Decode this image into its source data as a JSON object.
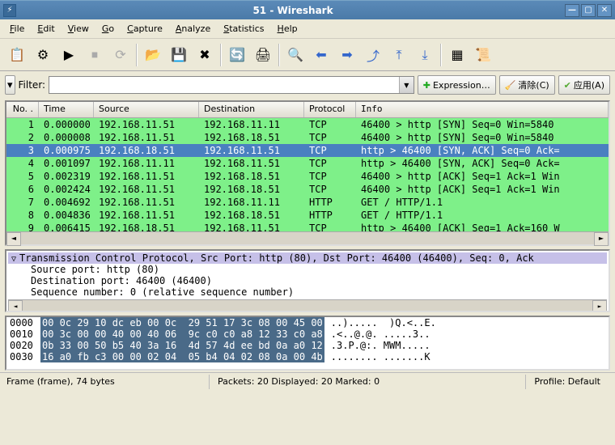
{
  "window": {
    "title": "51 - Wireshark"
  },
  "menubar": [
    "File",
    "Edit",
    "View",
    "Go",
    "Capture",
    "Analyze",
    "Statistics",
    "Help"
  ],
  "filterbar": {
    "filter_label": "Filter:",
    "expression_label": "Expression…",
    "clear_label": "清除(C)",
    "apply_label": "应用(A)",
    "filter_value": ""
  },
  "columns": [
    "No. .",
    "Time",
    "Source",
    "Destination",
    "Protocol",
    "Info"
  ],
  "rows": [
    {
      "no": "1",
      "time": "0.000000",
      "src": "192.168.11.51",
      "dst": "192.168.11.11",
      "proto": "TCP",
      "info": "46400 > http [SYN] Seq=0 Win=5840",
      "sel": false
    },
    {
      "no": "2",
      "time": "0.000008",
      "src": "192.168.11.51",
      "dst": "192.168.18.51",
      "proto": "TCP",
      "info": "46400 > http [SYN] Seq=0 Win=5840",
      "sel": false
    },
    {
      "no": "3",
      "time": "0.000975",
      "src": "192.168.18.51",
      "dst": "192.168.11.51",
      "proto": "TCP",
      "info": "http > 46400 [SYN, ACK] Seq=0 Ack=",
      "sel": true
    },
    {
      "no": "4",
      "time": "0.001097",
      "src": "192.168.11.11",
      "dst": "192.168.11.51",
      "proto": "TCP",
      "info": "http > 46400 [SYN, ACK] Seq=0 Ack=",
      "sel": false
    },
    {
      "no": "5",
      "time": "0.002319",
      "src": "192.168.11.51",
      "dst": "192.168.18.51",
      "proto": "TCP",
      "info": "46400 > http [ACK] Seq=1 Ack=1 Win",
      "sel": false
    },
    {
      "no": "6",
      "time": "0.002424",
      "src": "192.168.11.51",
      "dst": "192.168.18.51",
      "proto": "TCP",
      "info": "46400 > http [ACK] Seq=1 Ack=1 Win",
      "sel": false
    },
    {
      "no": "7",
      "time": "0.004692",
      "src": "192.168.11.51",
      "dst": "192.168.11.11",
      "proto": "HTTP",
      "info": "GET / HTTP/1.1",
      "sel": false
    },
    {
      "no": "8",
      "time": "0.004836",
      "src": "192.168.11.51",
      "dst": "192.168.18.51",
      "proto": "HTTP",
      "info": "GET / HTTP/1.1",
      "sel": false
    },
    {
      "no": "9",
      "time": "0.006415",
      "src": "192.168.18.51",
      "dst": "192.168.11.51",
      "proto": "TCP",
      "info": "http > 46400 [ACK] Seq=1 Ack=160 W",
      "sel": false
    }
  ],
  "detail": {
    "head": "Transmission Control Protocol, Src Port: http (80), Dst Port: 46400 (46400), Seq: 0, Ack",
    "lines": [
      "Source port: http (80)",
      "Destination port: 46400 (46400)",
      "Sequence number: 0    (relative sequence number)"
    ]
  },
  "hex": [
    {
      "off": "0000",
      "b": "00 0c 29 10 dc eb 00 0c  29 51 17 3c 08 00 45 00",
      "a": "..).....  )Q.<..E."
    },
    {
      "off": "0010",
      "b": "00 3c 00 00 40 00 40 06  9c c0 c0 a8 12 33 c0 a8",
      "a": ".<..@.@. .....3.."
    },
    {
      "off": "0020",
      "b": "0b 33 00 50 b5 40 3a 16  4d 57 4d ee bd 0a a0 12",
      "a": ".3.P.@:. MWM....."
    },
    {
      "off": "0030",
      "b": "16 a0 fb c3 00 00 02 04  05 b4 04 02 08 0a 00 4b",
      "a": "........ .......K"
    }
  ],
  "statusbar": {
    "frame": "Frame (frame), 74 bytes",
    "packets": "Packets: 20 Displayed: 20 Marked: 0",
    "profile": "Profile: Default"
  }
}
